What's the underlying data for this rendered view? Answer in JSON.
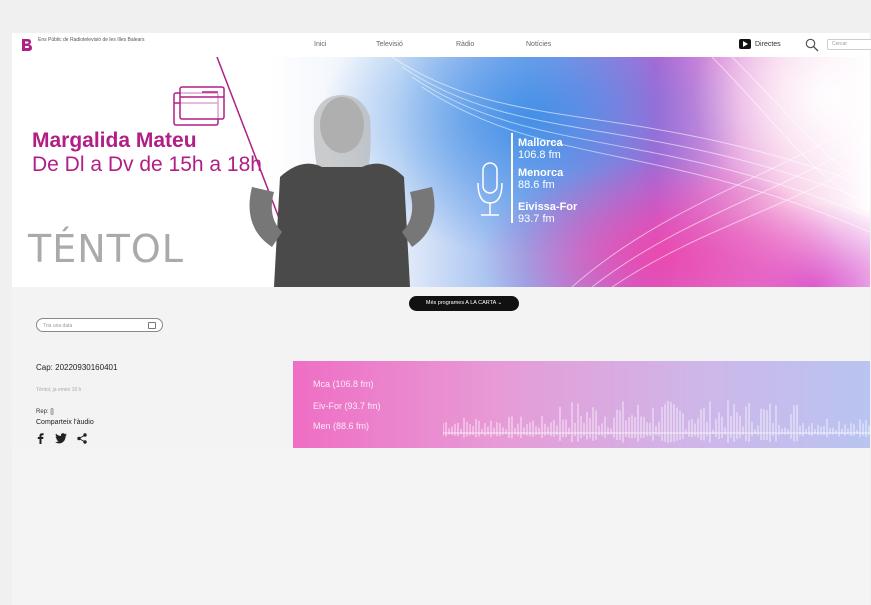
{
  "header": {
    "logo_text": "Ens Públic de Radiotelevisió de les Illes Balears",
    "nav": [
      "Inici",
      "Televisió",
      "Ràdio",
      "Notícies"
    ],
    "directes_label": "Directes",
    "search_placeholder": "Cercar"
  },
  "hero": {
    "host_name": "Margalida Mateu",
    "schedule": "De Dl a Dv de 15h a 18h",
    "program_title": "TÉNTOL",
    "stations": [
      {
        "name": "Mallorca",
        "freq": "106.8 fm"
      },
      {
        "name": "Menorca",
        "freq": "88.6 fm"
      },
      {
        "name": "Eivissa-For",
        "freq": "93.7 fm"
      }
    ]
  },
  "programs_button": "Més programes A LA CARTA",
  "date_picker_placeholder": "Tria una data",
  "episode": {
    "title": "Cap: 20220930160401",
    "meta": "Tèntol, ja emès 16 h",
    "rep": "Rep: []",
    "share_label": "Comparteix l'àudio"
  },
  "player": {
    "stations": [
      "Mca (106.8 fm)",
      "Eiv-For (93.7 fm)",
      "Men (88.6 fm)"
    ]
  },
  "colors": {
    "accent": "#b01f86",
    "dark": "#111111"
  }
}
